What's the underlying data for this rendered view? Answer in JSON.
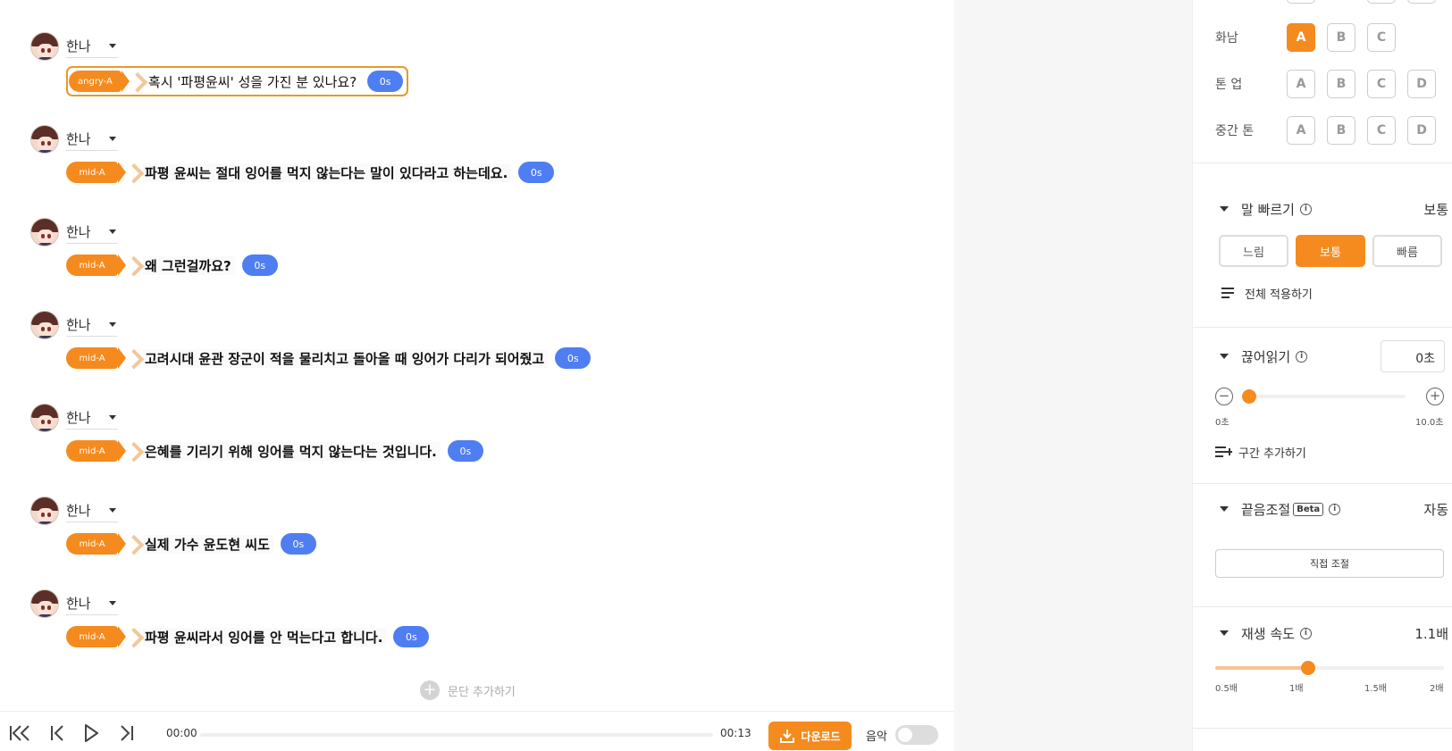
{
  "script": {
    "paragraphs": [
      {
        "speaker": "한나",
        "emotion": "angry-A",
        "text": "혹시 '파평윤씨' 성을 가진 분 있나요?",
        "duration": "0s",
        "selected": true
      },
      {
        "speaker": "한나",
        "emotion": "mid-A",
        "text": "파평 윤씨는 절대 잉어를 먹지 않는다는 말이 있다라고 하는데요.",
        "duration": "0s"
      },
      {
        "speaker": "한나",
        "emotion": "mid-A",
        "text": "왜 그런걸까요?",
        "duration": "0s"
      },
      {
        "speaker": "한나",
        "emotion": "mid-A",
        "text": "고려시대 윤관 장군이 적을 물리치고 돌아올 때 잉어가 다리가 되어줬고",
        "duration": "0s"
      },
      {
        "speaker": "한나",
        "emotion": "mid-A",
        "text": "은혜를 기리기 위해 잉어를 먹지 않는다는 것입니다.",
        "duration": "0s"
      },
      {
        "speaker": "한나",
        "emotion": "mid-A",
        "text": "실제 가수 윤도현 씨도",
        "duration": "0s"
      },
      {
        "speaker": "한나",
        "emotion": "mid-A",
        "text": "파평 윤씨라서 잉어를 안 먹는다고 합니다.",
        "duration": "0s"
      }
    ],
    "add_paragraph_label": "문단 추가하기"
  },
  "player": {
    "current_time": "00:00",
    "total_time": "00:13",
    "progress": 0,
    "download_label": "다운로드",
    "music_label": "음악",
    "music_on": false
  },
  "panel": {
    "tone_rows": [
      {
        "label": "화남",
        "options": [
          "A",
          "B",
          "C"
        ],
        "selected": "A"
      },
      {
        "label": "톤 업",
        "options": [
          "A",
          "B",
          "C",
          "D"
        ],
        "selected": null
      },
      {
        "label": "중간 톤",
        "options": [
          "A",
          "B",
          "C",
          "D"
        ],
        "selected": null
      }
    ],
    "speech_speed": {
      "title": "말 빠르기",
      "value": "보통",
      "options": [
        "느림",
        "보통",
        "빠름"
      ],
      "selected": "보통",
      "apply_all_label": "전체 적용하기"
    },
    "pause": {
      "title": "끊어읽기",
      "value": "0초",
      "min_label": "0초",
      "max_label": "10.0초",
      "level": 0,
      "add_section_label": "구간 추가하기"
    },
    "ending": {
      "title": "끝음조절",
      "badge": "Beta",
      "value": "자동",
      "manual_label": "직접 조절"
    },
    "playback_speed": {
      "title": "재생 속도",
      "value": "1.1배",
      "ticks": [
        "0.5배",
        "1배",
        "1.5배",
        "2배"
      ],
      "level": 1.1,
      "min": 0.5,
      "max": 2
    }
  },
  "colors": {
    "accent": "#f58b1f",
    "duration_badge": "#4f7ef3"
  }
}
